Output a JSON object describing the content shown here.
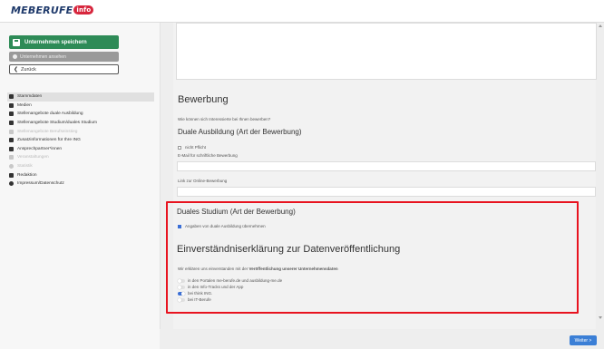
{
  "header": {
    "logo_text": "MEBERUFE",
    "logo_badge": "info"
  },
  "sidebar": {
    "save_label": "Unternehmen speichern",
    "view_label": "Unternehmen ansehen",
    "back_label": "Zurück",
    "items": [
      {
        "label": "Stammdaten",
        "state": "active"
      },
      {
        "label": "Medien",
        "state": "normal"
      },
      {
        "label": "Stellenangebote duale Ausbildung",
        "state": "normal"
      },
      {
        "label": "Stellenangebote Studium/duales Studium",
        "state": "normal"
      },
      {
        "label": "Stellenangebote Berufseinstieg",
        "state": "disabled"
      },
      {
        "label": "Zusatzinformationen für Ihre ING",
        "state": "normal"
      },
      {
        "label": "Ansprechpartner*innen",
        "state": "normal"
      },
      {
        "label": "Veranstaltungen",
        "state": "disabled"
      },
      {
        "label": "Statistik",
        "state": "disabled"
      },
      {
        "label": "Redaktion",
        "state": "normal"
      },
      {
        "label": "Impressum/Datenschutz",
        "state": "normal"
      }
    ]
  },
  "main": {
    "bewerbung_title": "Bewerbung",
    "bewerbung_question": "Wie können sich Interessierte bei Ihnen bewerben?",
    "duale_ausbildung_title": "Duale Ausbildung (Art der Bewerbung)",
    "nicht_pflicht_label": "nicht Pflicht",
    "email_label": "E-Mail für schriftliche Bewerbung",
    "online_link_label": "Link zur Online-Bewerbung",
    "duales_studium_title": "Duales Studium (Art der Bewerbung)",
    "uebernehmen_label": "Angaben von duale Ausbildung übernehmen",
    "consent_title": "Einverständniserklärung zur Datenveröffentlichung",
    "consent_text_prefix": "Wir erklären uns einverstanden mit der ",
    "consent_text_bold": "Veröffentlichung unserer Unternehmensdaten",
    "options": [
      {
        "label": "in den Portalen me-berufe.de und ausbildung-me.de",
        "on": false
      },
      {
        "label": "in den Info-Tracks und der App",
        "on": false
      },
      {
        "label": "bei think ING.",
        "on": true
      },
      {
        "label": "bei IT-Berufe",
        "on": false
      }
    ]
  },
  "footer": {
    "next_label": "Weiter >"
  },
  "colors": {
    "accent_green": "#2e8b57",
    "accent_blue": "#3b6fd6",
    "highlight_red": "#e8131f"
  }
}
